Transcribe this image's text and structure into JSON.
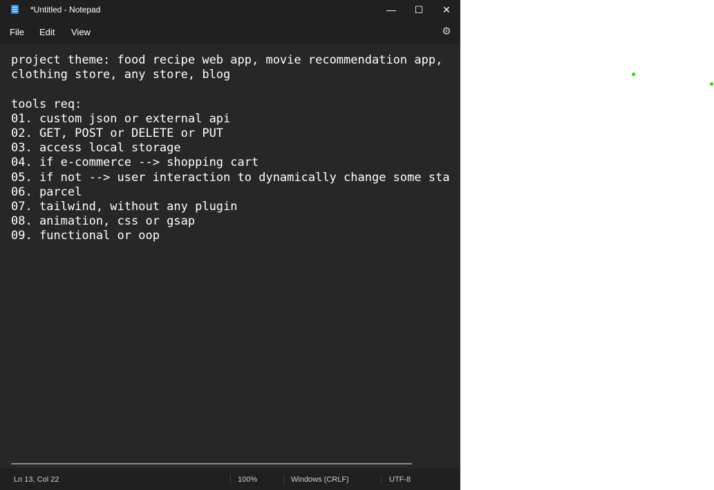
{
  "window": {
    "title": "*Untitled - Notepad",
    "controls": {
      "minimize": "—",
      "maximize": "☐",
      "close": "✕"
    }
  },
  "menu": {
    "file": "File",
    "edit": "Edit",
    "view": "View"
  },
  "editor": {
    "lines": [
      "project theme: food recipe web app, movie recommendation app,",
      "clothing store, any store, blog",
      "",
      "tools req:",
      "01. custom json or external api",
      "02. GET, POST or DELETE or PUT",
      "03. access local storage",
      "04. if e-commerce --> shopping cart",
      "05. if not --> user interaction to dynamically change some sta",
      "06. parcel",
      "07. tailwind, without any plugin",
      "08. animation, css or gsap",
      "09. functional or oop"
    ]
  },
  "status": {
    "position": "Ln 13, Col 22",
    "zoom": "100%",
    "line_ending": "Windows (CRLF)",
    "encoding": "UTF-8"
  },
  "colors": {
    "editor_bg": "#272727",
    "chrome_bg": "#202020",
    "text": "#ffffff",
    "marker_green": "#22dd00"
  }
}
